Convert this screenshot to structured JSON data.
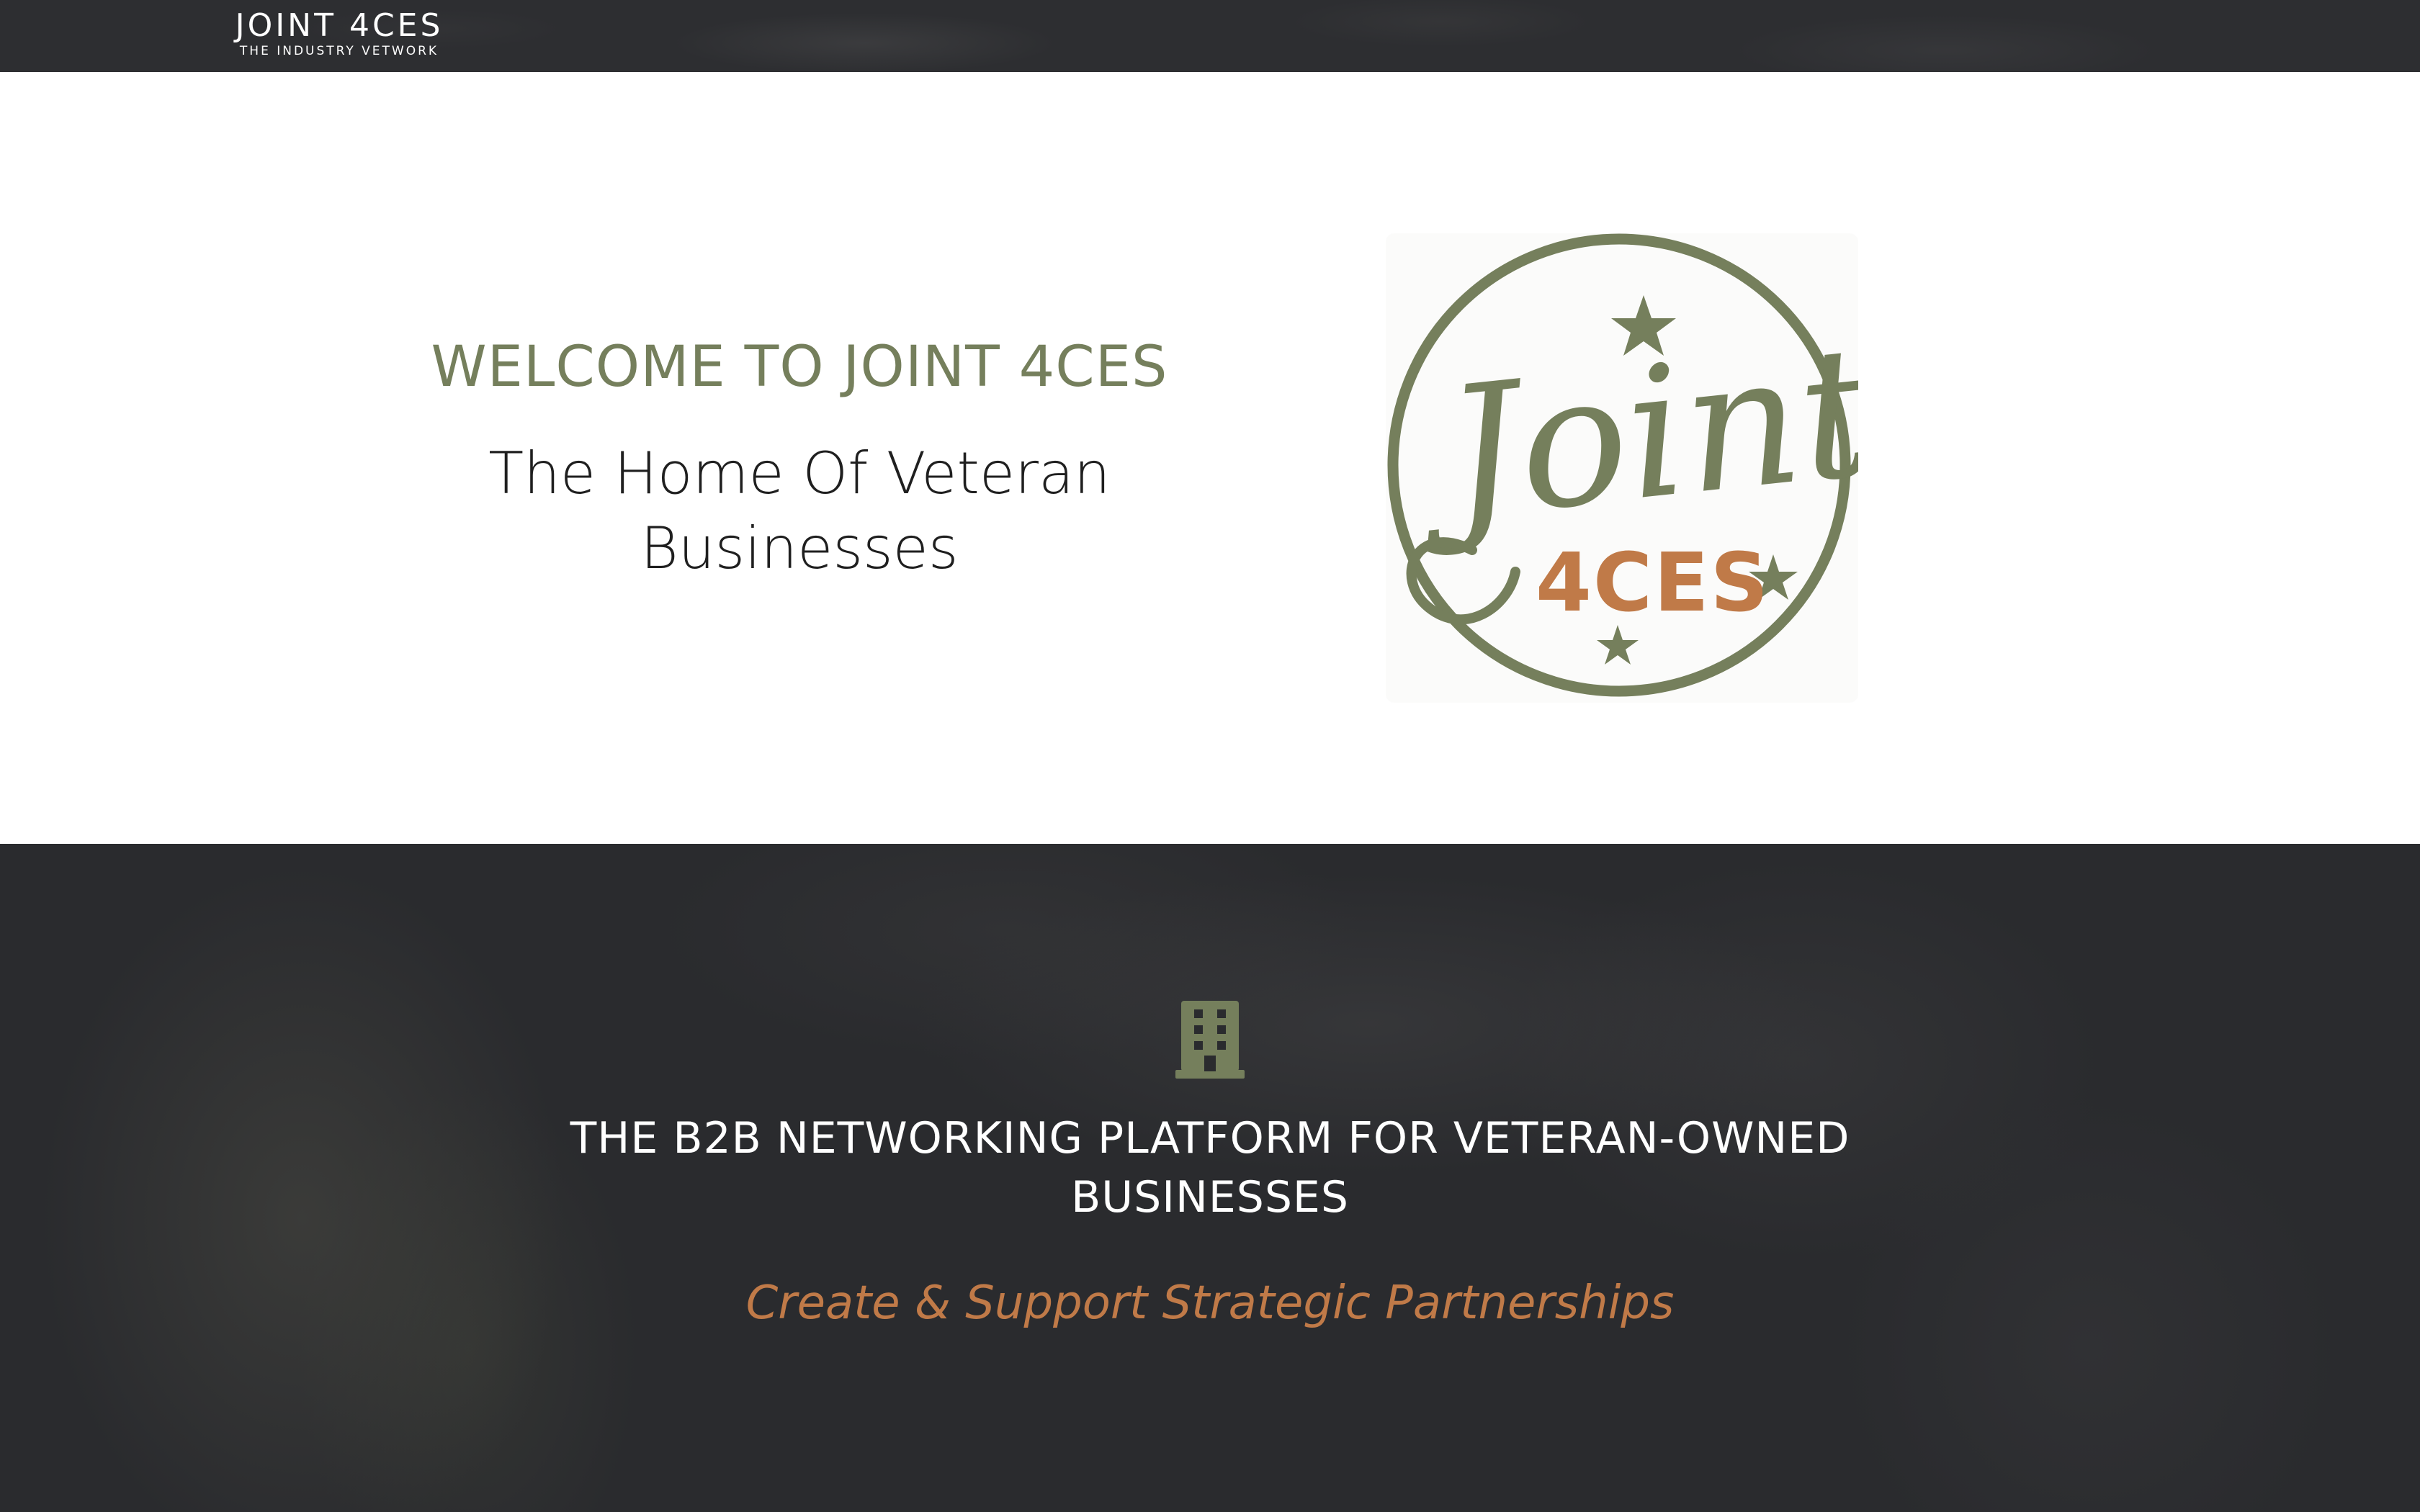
{
  "nav": {
    "brand_title": "JOINT 4CES",
    "brand_subtitle": "THE INDUSTRY VETWORK"
  },
  "hero": {
    "heading": "WELCOME TO JOINT 4CES",
    "subheading": "The Home Of Veteran Businesses",
    "logo": {
      "script_text": "Joint",
      "block_text": "4CES",
      "icon": "joint-4ces-circle-logo"
    }
  },
  "band": {
    "icon": "building-icon",
    "heading": "THE B2B NETWORKING PLATFORM FOR VETERAN-OWNED BUSINESSES",
    "tagline": "Create & Support Strategic Partnerships"
  },
  "colors": {
    "olive": "#757f5c",
    "copper": "#c07a48",
    "dark": "#2a2b2e",
    "white": "#ffffff"
  }
}
